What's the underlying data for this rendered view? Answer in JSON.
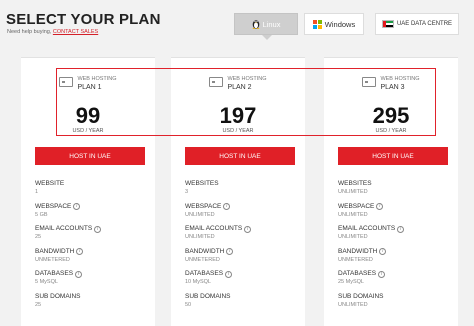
{
  "header": {
    "title": "SELECT YOUR PLAN",
    "help_text": "Need help buying, ",
    "contact_link": "CONTACT SALES"
  },
  "os_tabs": [
    {
      "label": "Linux",
      "icon": "linux-penguin-icon",
      "selected": true
    },
    {
      "label": "Windows",
      "icon": "windows-logo-icon",
      "selected": false
    },
    {
      "label": "UAE DATA CENTRE",
      "icon": "uae-flag-icon",
      "selected": false
    }
  ],
  "colors": {
    "accent": "#e02027",
    "highlight_border": "#e0222b",
    "tab_selected": "#cfcfcf"
  },
  "plans": [
    {
      "sub_label": "WEB HOSTING",
      "name": "PLAN 1",
      "price": "99",
      "period": "USD / YEAR",
      "button": "HOST IN UAE",
      "features": [
        {
          "label": "WEBSITE",
          "value": "1",
          "info": false
        },
        {
          "label": "WEBSPACE",
          "value": "5 GB",
          "info": true
        },
        {
          "label": "EMAIL ACCOUNTS",
          "value": "25",
          "info": true
        },
        {
          "label": "BANDWIDTH",
          "value": "UNMETERED",
          "info": true
        },
        {
          "label": "DATABASES",
          "value": "5 MySQL",
          "info": true
        },
        {
          "label": "SUB DOMAINS",
          "value": "25",
          "info": false
        }
      ]
    },
    {
      "sub_label": "WEB HOSTING",
      "name": "PLAN 2",
      "price": "197",
      "period": "USD / YEAR",
      "button": "HOST IN UAE",
      "features": [
        {
          "label": "WEBSITES",
          "value": "3",
          "info": false
        },
        {
          "label": "WEBSPACE",
          "value": "UNLIMITED",
          "info": true
        },
        {
          "label": "EMAIL ACCOUNTS",
          "value": "UNLIMITED",
          "info": true
        },
        {
          "label": "BANDWIDTH",
          "value": "UNMETERED",
          "info": true
        },
        {
          "label": "DATABASES",
          "value": "10 MySQL",
          "info": true
        },
        {
          "label": "SUB DOMAINS",
          "value": "50",
          "info": false
        }
      ]
    },
    {
      "sub_label": "WEB HOSTING",
      "name": "PLAN 3",
      "price": "295",
      "period": "USD / YEAR",
      "button": "HOST IN UAE",
      "features": [
        {
          "label": "WEBSITES",
          "value": "UNLIMITED",
          "info": false
        },
        {
          "label": "WEBSPACE",
          "value": "UNLIMITED",
          "info": true
        },
        {
          "label": "EMAIL ACCOUNTS",
          "value": "UNLIMITED",
          "info": true
        },
        {
          "label": "BANDWIDTH",
          "value": "UNMETERED",
          "info": true
        },
        {
          "label": "DATABASES",
          "value": "25 MySQL",
          "info": true
        },
        {
          "label": "SUB DOMAINS",
          "value": "UNLIMITED",
          "info": false
        }
      ]
    }
  ]
}
